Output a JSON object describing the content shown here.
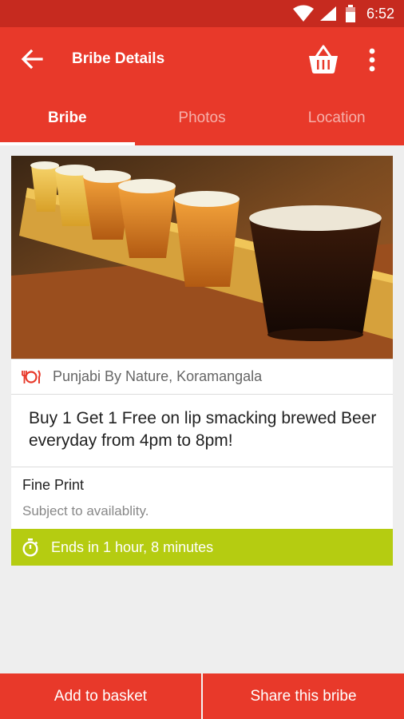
{
  "status_bar": {
    "time": "6:52",
    "icons": [
      "wifi-icon",
      "signal-icon",
      "battery-icon"
    ]
  },
  "app_bar": {
    "title": "Bribe Details",
    "icons": [
      "back-arrow-icon",
      "basket-icon",
      "more-vert-icon"
    ]
  },
  "tabs": [
    {
      "label": "Bribe",
      "active": true
    },
    {
      "label": "Photos",
      "active": false
    },
    {
      "label": "Location",
      "active": false
    }
  ],
  "bribe": {
    "venue": "Punjabi By Nature, Koramangala",
    "offer": "Buy 1 Get 1 Free on lip smacking brewed Beer everyday from 4pm to 8pm!",
    "fine_print_heading": "Fine Print",
    "fine_print_text": "Subject to availablity.",
    "timer": "Ends in 1 hour, 8 minutes"
  },
  "actions": {
    "add_to_basket": "Add to basket",
    "share": "Share this bribe"
  },
  "colors": {
    "primary": "#e8392a",
    "primary_dark": "#c62a1f",
    "timer_bar": "#b5cc11"
  }
}
